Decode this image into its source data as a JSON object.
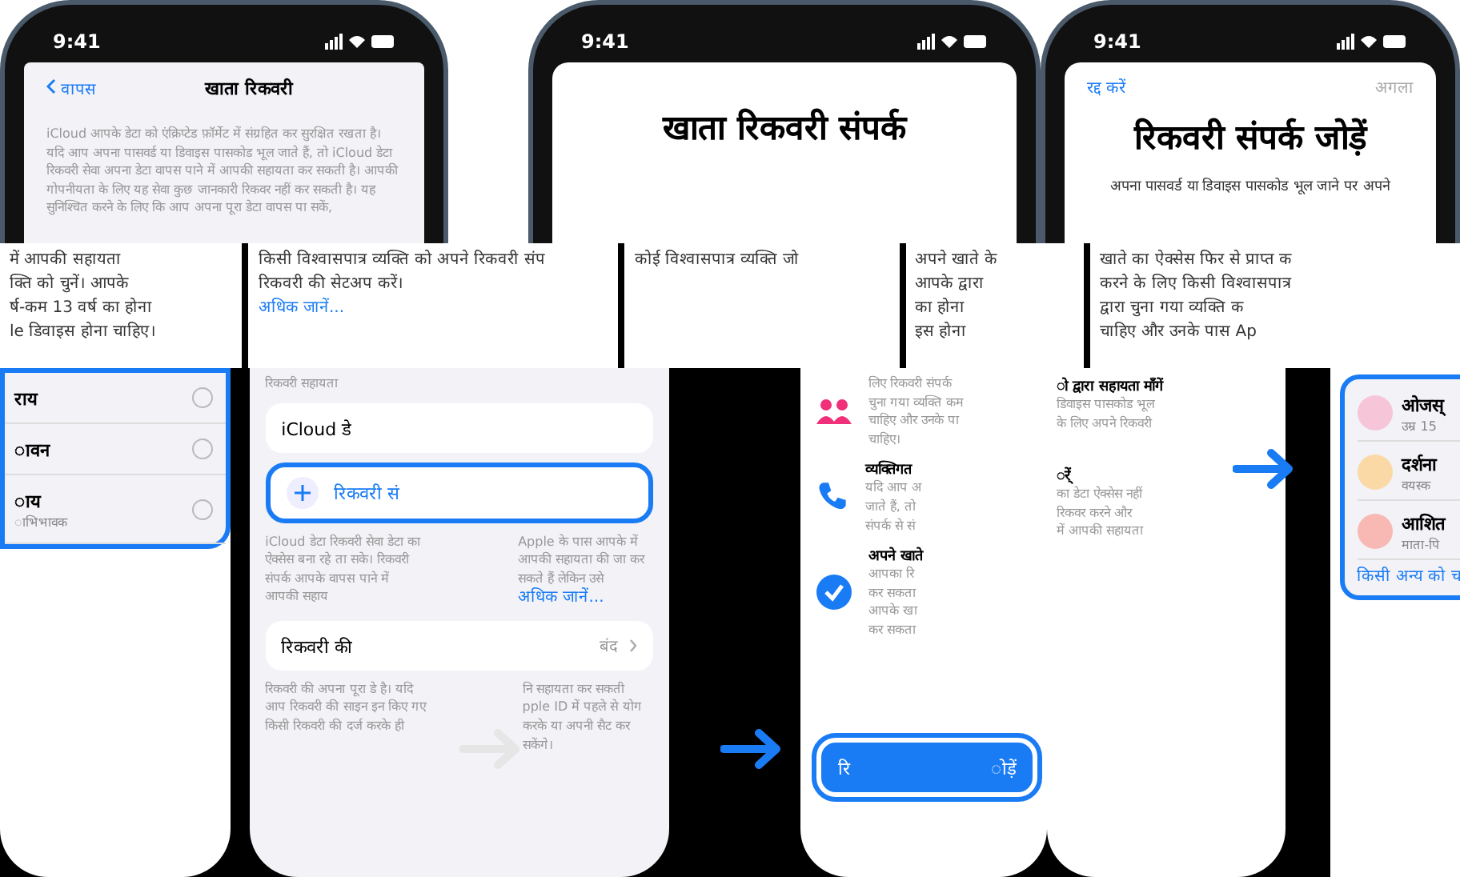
{
  "phones": [
    {
      "time": "9:41",
      "back": "वापस",
      "title": "खाता रिकवरी",
      "body": "iCloud आपके डेटा को एंक्रिप्टेड फ़ॉर्मेट में संग्रहित कर सुरक्षित रखता है। यदि आप अपना पासवर्ड या डिवाइस पासकोड भूल जाते हैं, तो iCloud डेटा रिकवरी सेवा अपना डेटा वापस पाने में आपकी सहायता कर सकती है। आपकी गोपनीयता के लिए यह सेवा कुछ जानकारी रिकवर नहीं कर सकती है। यह सुनिश्चित करने के लिए कि आप अपना पूरा डेटा वापस पा सकें,"
    },
    {
      "time": "9:41",
      "title": "खाता रिकवरी संपर्क"
    },
    {
      "time": "9:41",
      "cancel": "रद्द करें",
      "next": "अगला",
      "title": "रिकवरी संपर्क जोड़ें",
      "body": "अपना पासवर्ड या डिवाइस पासकोड भूल जाने पर अपने"
    }
  ],
  "band": [
    {
      "lines": [
        "में आपकी सहायता",
        "क्ति को चुनें। आपके",
        "र्ष-कम 13 वर्ष का होना",
        "le डिवाइस होना चाहिए।"
      ]
    },
    {
      "lines": [
        "किसी विश्वासपात्र व्यक्ति को अपने रिकवरी संप",
        "रिकवरी की सेटअप करें।"
      ],
      "link": "अधिक जानें..."
    },
    {
      "lines": [
        "कोई विश्वासपात्र व्यक्ति जो"
      ]
    },
    {
      "lines": [
        "अपने खाते के",
        "आपके द्वारा",
        "का होना",
        "इस होना"
      ]
    },
    {
      "lines": [
        "खाते का ऐक्सेस फिर से प्राप्त क",
        "करने के लिए किसी विश्वासपात्र",
        "द्वारा चुना गया व्यक्ति क",
        "चाहिए और उनके पास Ap"
      ]
    }
  ],
  "options": [
    {
      "label": "राय",
      "selected": false
    },
    {
      "label": "ावन",
      "selected": false
    },
    {
      "label": "ाय",
      "sub": "ाभिभावक",
      "selected": false
    }
  ],
  "settings": {
    "section": "रिकवरी सहायता",
    "account": "iCloud डे",
    "add": "रिकवरी सं",
    "note_left": "iCloud डेटा रिकवरी सेवा डेटा का ऐक्सेस बना रहे ता सके। रिकवरी संपर्क आपके वापस पाने में आपकी सहाय",
    "note_right": "Apple के पास आपके में आपकी सहायता की जा कर सकते हैं लेकिन उसे",
    "note_link": "अधिक जानें...",
    "row": "रिकवरी की",
    "row_value": "बंद",
    "foot_left": "रिकवरी की अपना पूरा डे है। यदि आप रिकवरी की साइन इन किए गए किसी रिकवरी की दर्ज करके ही",
    "foot_right": "नि सहायता कर सकती pple ID में पहले से योग करके या अपनी सैट कर सकेंगे।"
  },
  "tips": [
    {
      "kind": "people",
      "lines": [
        "लिए रिकवरी संपर्क",
        "चुना गया व्यक्ति कम",
        "चाहिए और उनके पा",
        "चाहिए।"
      ]
    },
    {
      "kind": "phone",
      "title": "व्यक्तिगत",
      "lines": [
        "यदि आप अ",
        "जाते हैं, तो",
        "संपर्क से सं"
      ]
    },
    {
      "kind": "check",
      "title": "अपने खाते",
      "lines": [
        "आपका रि",
        "कर सकता",
        "आपके खा",
        "कर सकता"
      ]
    }
  ],
  "tips_right": [
    {
      "title": "ो द्वारा सहायता माँगें",
      "lines": [
        "डिवाइस पासकोड भूल",
        "के लिए अपने रिकवरी"
      ]
    },
    {
      "title": "र्ें",
      "lines": [
        "का डेटा ऐक्सेस नहीं",
        "रिकवर करने और",
        "में आपकी सहायता"
      ]
    }
  ],
  "button_left": "रि",
  "button_right": "ोड़ें",
  "contacts": [
    {
      "name": "ओजस्",
      "sub": "उम्र 15",
      "color": "#f6c6d8"
    },
    {
      "name": "दर्शना",
      "sub": "वयस्क",
      "color": "#fbd9a6"
    },
    {
      "name": "आशित",
      "sub": "माता-पि",
      "color": "#f8b9b4"
    }
  ],
  "contacts_link": "किसी अन्य को च"
}
